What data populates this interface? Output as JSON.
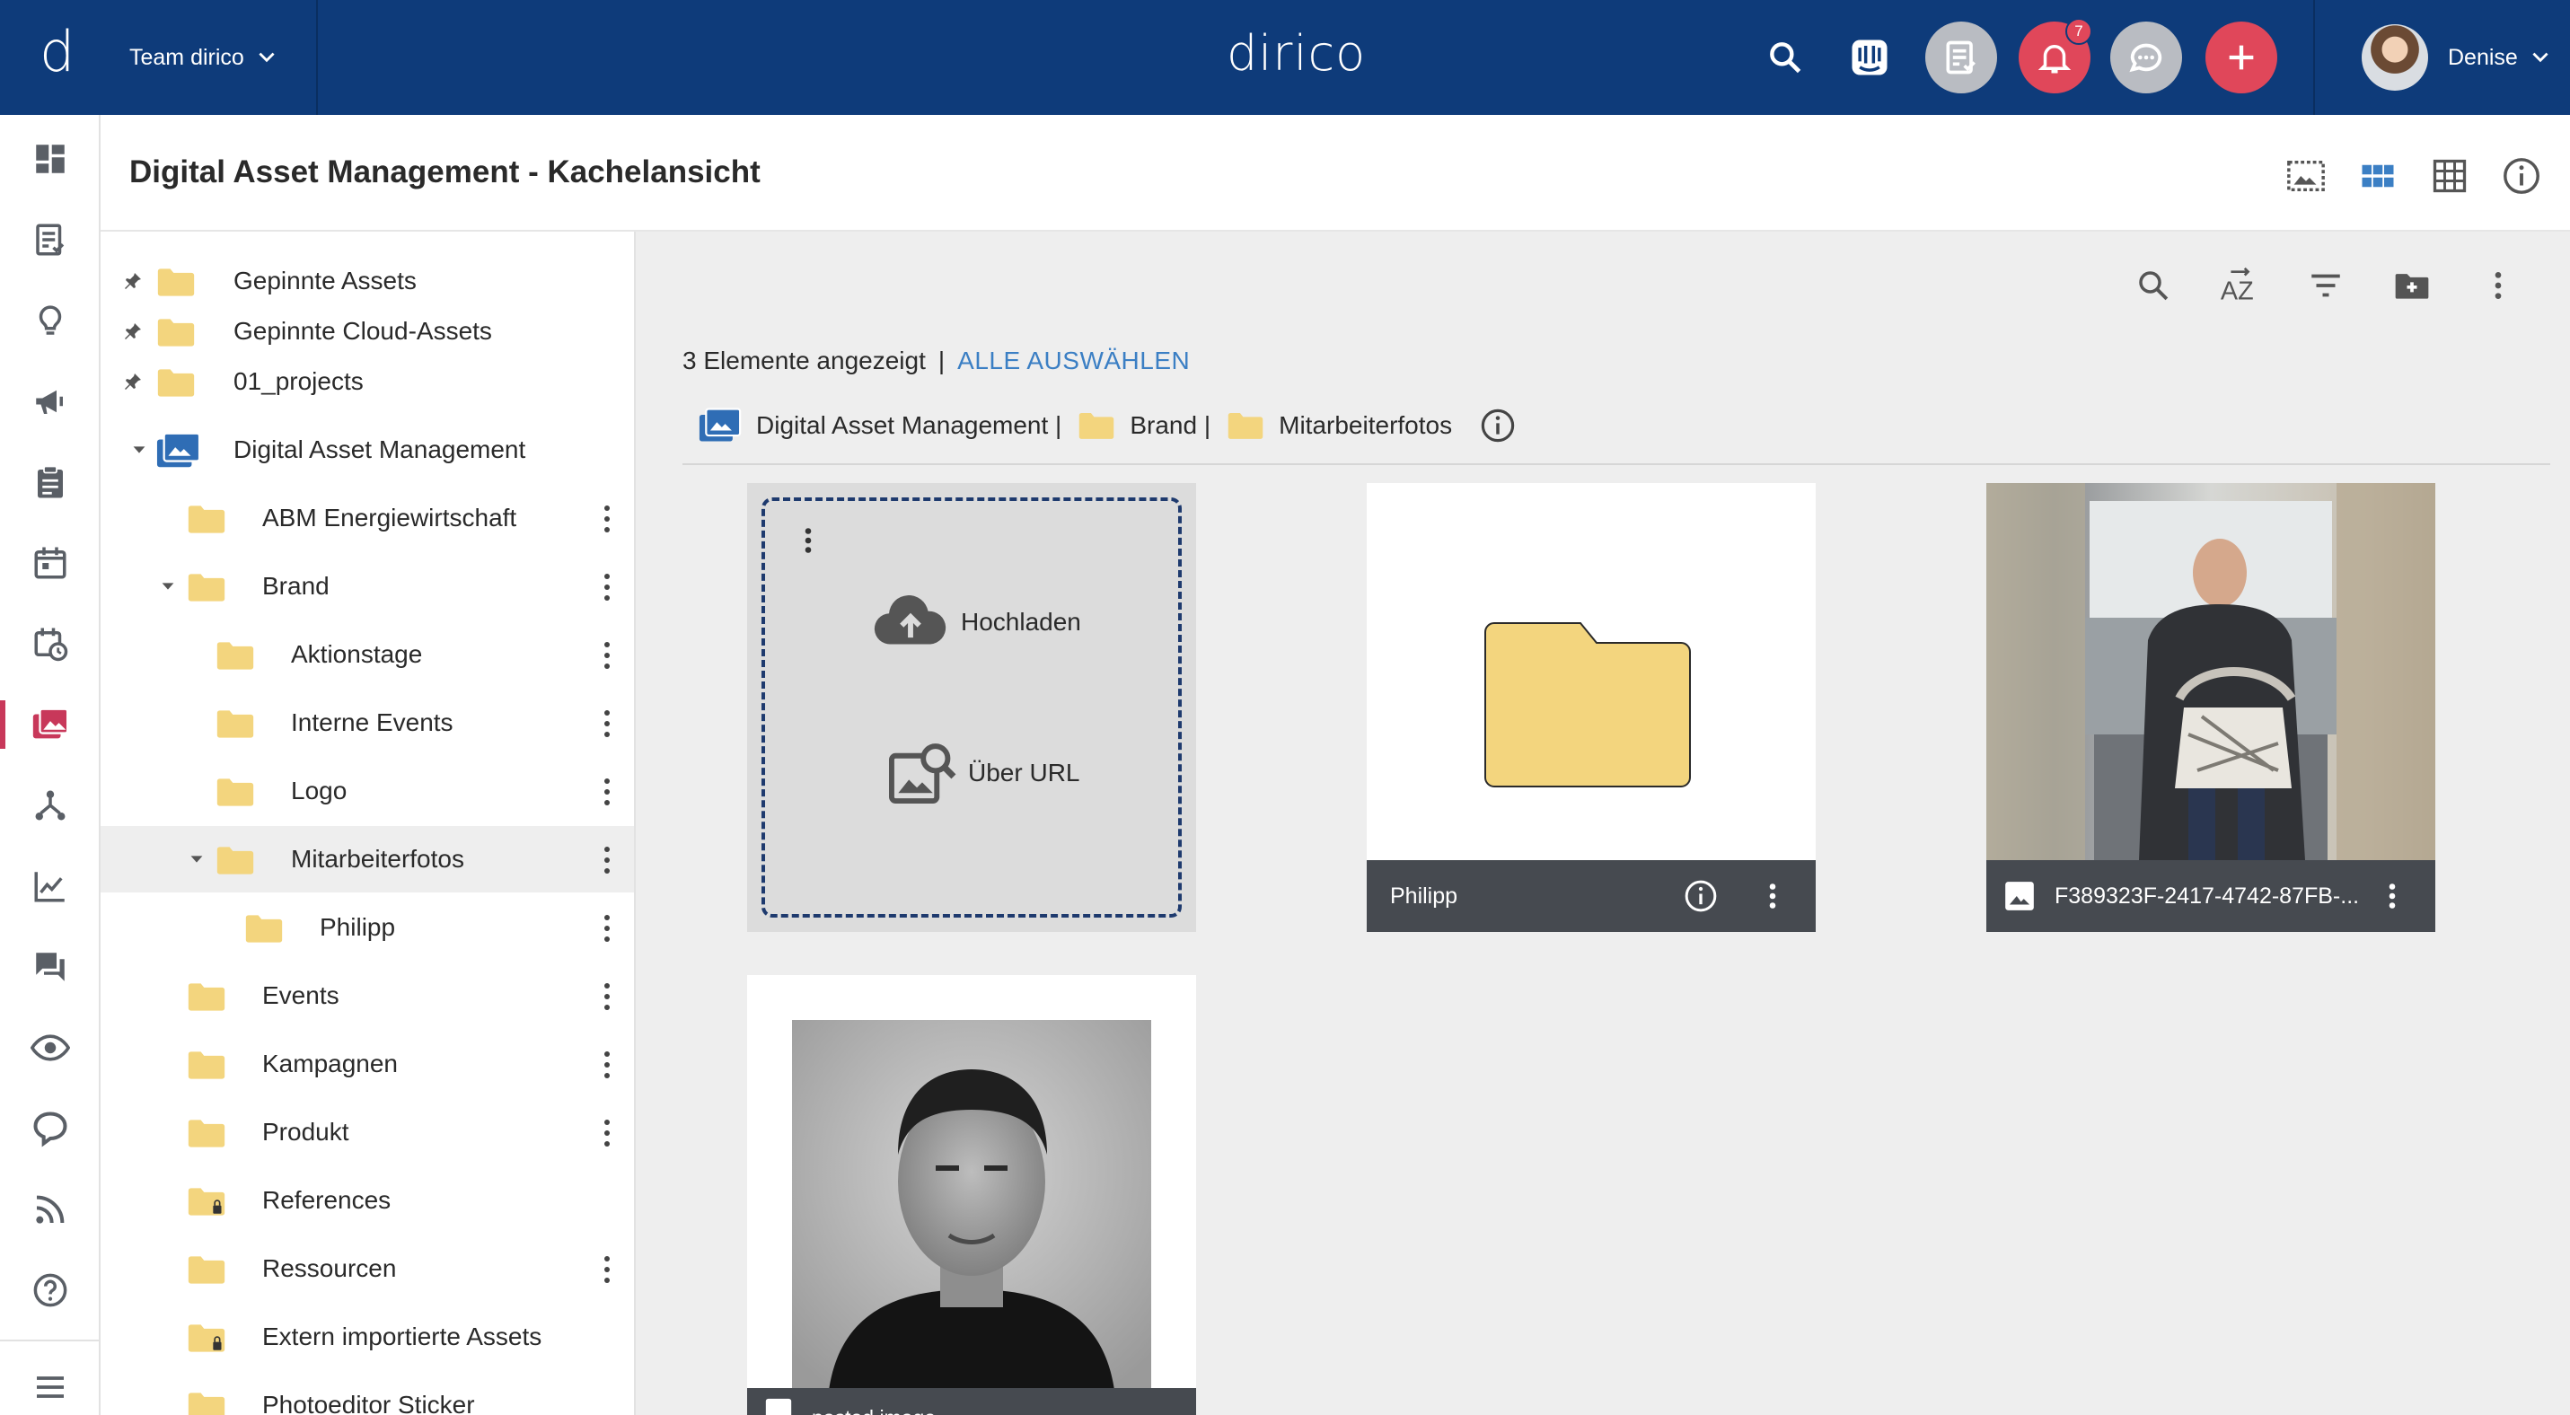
{
  "topbar": {
    "logo_letter": "d",
    "team_label": "Team dirico",
    "brand": "dirico",
    "notification_count": "7",
    "user_name": "Denise"
  },
  "page": {
    "title": "Digital Asset Management - Kachelansicht"
  },
  "tree": {
    "pinned": [
      {
        "label": "Gepinnte Assets"
      },
      {
        "label": "Gepinnte Cloud-Assets"
      },
      {
        "label": "01_projects"
      }
    ],
    "root": {
      "label": "Digital Asset Management"
    },
    "items": [
      {
        "label": "ABM Energiewirtschaft",
        "level": 1,
        "caret": false,
        "kebab": true,
        "locked": false
      },
      {
        "label": "Brand",
        "level": 1,
        "caret": true,
        "kebab": true,
        "locked": false
      },
      {
        "label": "Aktionstage",
        "level": 2,
        "caret": false,
        "kebab": true,
        "locked": false
      },
      {
        "label": "Interne Events",
        "level": 2,
        "caret": false,
        "kebab": true,
        "locked": false
      },
      {
        "label": "Logo",
        "level": 2,
        "caret": false,
        "kebab": true,
        "locked": false
      },
      {
        "label": "Mitarbeiterfotos",
        "level": 2,
        "caret": true,
        "kebab": true,
        "locked": false,
        "selected": true
      },
      {
        "label": "Philipp",
        "level": 3,
        "caret": false,
        "kebab": true,
        "locked": false
      },
      {
        "label": "Events",
        "level": 1,
        "caret": false,
        "kebab": true,
        "locked": false
      },
      {
        "label": "Kampagnen",
        "level": 1,
        "caret": false,
        "kebab": true,
        "locked": false
      },
      {
        "label": "Produkt",
        "level": 1,
        "caret": false,
        "kebab": true,
        "locked": false
      },
      {
        "label": "References",
        "level": 1,
        "caret": false,
        "kebab": false,
        "locked": true
      },
      {
        "label": "Ressourcen",
        "level": 1,
        "caret": false,
        "kebab": true,
        "locked": false
      },
      {
        "label": "Extern importierte Assets",
        "level": 1,
        "caret": false,
        "kebab": false,
        "locked": true
      },
      {
        "label": "Photoeditor Sticker",
        "level": 1,
        "caret": false,
        "kebab": false,
        "locked": false
      }
    ]
  },
  "content": {
    "count_text": "3 Elemente angezeigt",
    "separator": "|",
    "select_all": "ALLE AUSWÄHLEN",
    "breadcrumbs": [
      {
        "label": "Digital Asset Management |"
      },
      {
        "label": "Brand |"
      },
      {
        "label": "Mitarbeiterfotos"
      }
    ],
    "upload_label": "Hochladen",
    "url_label": "Über URL",
    "tiles": [
      {
        "name": "Philipp",
        "kind": "folder"
      },
      {
        "name": "F389323F-2417-4742-87FB-...",
        "kind": "image"
      },
      {
        "name": "pasted image",
        "kind": "image"
      }
    ]
  },
  "colors": {
    "topbar": "#0e3b7a",
    "accent_red": "#e0475a",
    "link_blue": "#3b7fc4",
    "folder": "#f3d57e",
    "active_rail": "#c8385a"
  }
}
